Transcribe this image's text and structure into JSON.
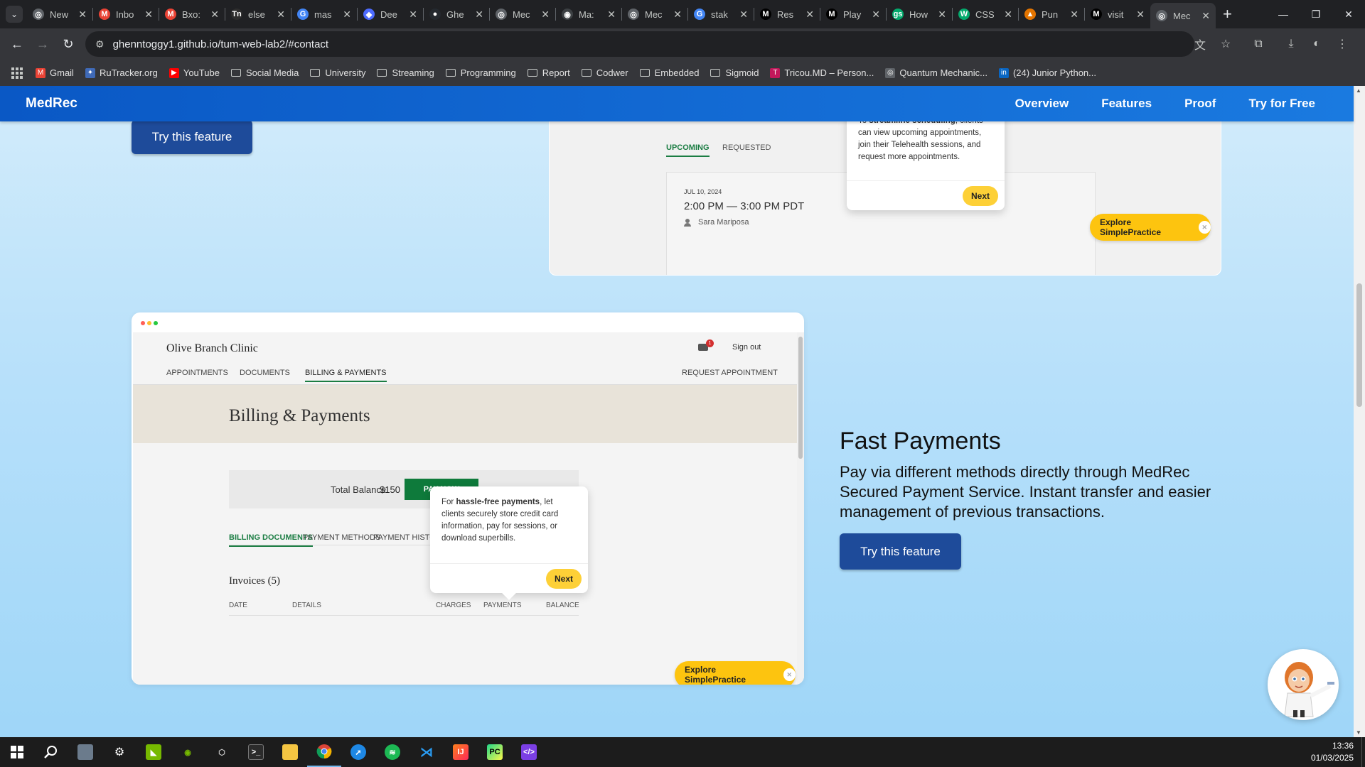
{
  "browser": {
    "tabs": [
      {
        "title": "New",
        "fav_color": "#5f6368",
        "fav_glyph": "◎"
      },
      {
        "title": "Inbo",
        "fav_color": "#ea4335",
        "fav_glyph": "M"
      },
      {
        "title": "Bxo:",
        "fav_color": "#ea4335",
        "fav_glyph": "M"
      },
      {
        "title": "else",
        "fav_color": "#2d2d2d",
        "fav_glyph": "Tn"
      },
      {
        "title": "mas",
        "fav_color": "#4285f4",
        "fav_glyph": "G"
      },
      {
        "title": "Dee",
        "fav_color": "#4d6bfe",
        "fav_glyph": "◆"
      },
      {
        "title": "Ghe",
        "fav_color": "#24292f",
        "fav_glyph": "●"
      },
      {
        "title": "Mec",
        "fav_color": "#5f6368",
        "fav_glyph": "◎"
      },
      {
        "title": "Ma:",
        "fav_color": "#3c4043",
        "fav_glyph": "◉"
      },
      {
        "title": "Mec",
        "fav_color": "#5f6368",
        "fav_glyph": "◎"
      },
      {
        "title": "stak",
        "fav_color": "#4285f4",
        "fav_glyph": "G"
      },
      {
        "title": "Res",
        "fav_color": "#000000",
        "fav_glyph": "M"
      },
      {
        "title": "Play",
        "fav_color": "#000000",
        "fav_glyph": "M"
      },
      {
        "title": "How",
        "fav_color": "#04aa6d",
        "fav_glyph": "gs"
      },
      {
        "title": "CSS",
        "fav_color": "#04aa6d",
        "fav_glyph": "W"
      },
      {
        "title": "Pun",
        "fav_color": "#e37400",
        "fav_glyph": "▲"
      },
      {
        "title": "visit",
        "fav_color": "#000000",
        "fav_glyph": "M"
      },
      {
        "title": "Mec",
        "fav_color": "#5f6368",
        "fav_glyph": "◎"
      }
    ],
    "url": "ghenntoggy1.github.io/tum-web-lab2/#contact",
    "bookmarks": [
      {
        "label": "Gmail",
        "type": "icon",
        "color": "#ea4335",
        "glyph": "M"
      },
      {
        "label": "RuTracker.org",
        "type": "icon",
        "color": "#3f6ab8",
        "glyph": "✦"
      },
      {
        "label": "YouTube",
        "type": "icon",
        "color": "#ff0000",
        "glyph": "▶"
      },
      {
        "label": "Social Media",
        "type": "folder"
      },
      {
        "label": "University",
        "type": "folder"
      },
      {
        "label": "Streaming",
        "type": "folder"
      },
      {
        "label": "Programming",
        "type": "folder"
      },
      {
        "label": "Report",
        "type": "folder"
      },
      {
        "label": "Codwer",
        "type": "folder"
      },
      {
        "label": "Embedded",
        "type": "folder"
      },
      {
        "label": "Sigmoid",
        "type": "folder"
      },
      {
        "label": "Tricou.MD – Person...",
        "type": "icon",
        "color": "#c2185b",
        "glyph": "T"
      },
      {
        "label": "Quantum Mechanic...",
        "type": "icon",
        "color": "#5f6368",
        "glyph": "◎"
      },
      {
        "label": "(24) Junior Python...",
        "type": "icon",
        "color": "#0a66c2",
        "glyph": "in"
      }
    ]
  },
  "site": {
    "brand": "MedRec",
    "nav": [
      "Overview",
      "Features",
      "Proof",
      "Try for Free"
    ],
    "try_feature_label": "Try this feature",
    "accent": "#1e4b9a"
  },
  "top_card": {
    "tabs": {
      "upcoming": "UPCOMING",
      "requested": "REQUESTED"
    },
    "appointment": {
      "date": "JUL 10, 2024",
      "time": "2:00 PM — 3:00 PM PDT",
      "person": "Sara Mariposa"
    },
    "tip": {
      "pre": "To ",
      "bold": "streamline scheduling",
      "post": ", clients can view upcoming appointments, join their Telehealth sessions, and request more appointments.",
      "next": "Next"
    },
    "explore": "Explore SimplePractice"
  },
  "billing_card": {
    "clinic_name": "Olive Branch Clinic",
    "notification_count": "1",
    "sign_out": "Sign out",
    "nav": [
      "APPOINTMENTS",
      "DOCUMENTS",
      "BILLING & PAYMENTS"
    ],
    "request_appointment": "REQUEST APPOINTMENT",
    "title": "Billing & Payments",
    "tip": {
      "pre": "For ",
      "bold": "hassle-free payments",
      "post": ", let clients securely store credit card information, pay for sessions, or download superbills.",
      "next": "Next"
    },
    "total_balance_label": "Total Balance",
    "total_balance_value": "$150",
    "pay_now": "PAY NOW",
    "sub_tabs": [
      "BILLING DOCUMENTS",
      "PAYMENT METHODS",
      "PAYMENT HISTORY"
    ],
    "invoices": "Invoices (5)",
    "columns": [
      "DATE",
      "DETAILS",
      "CHARGES",
      "PAYMENTS",
      "BALANCE"
    ],
    "explore": "Explore SimplePractice"
  },
  "feature": {
    "title": "Fast Payments",
    "description": "Pay via different methods directly through MedRec Secured Payment Service. Instant transfer and easier management of previous transactions."
  },
  "taskbar": {
    "time": "13:36",
    "date": "01/03/2025"
  }
}
